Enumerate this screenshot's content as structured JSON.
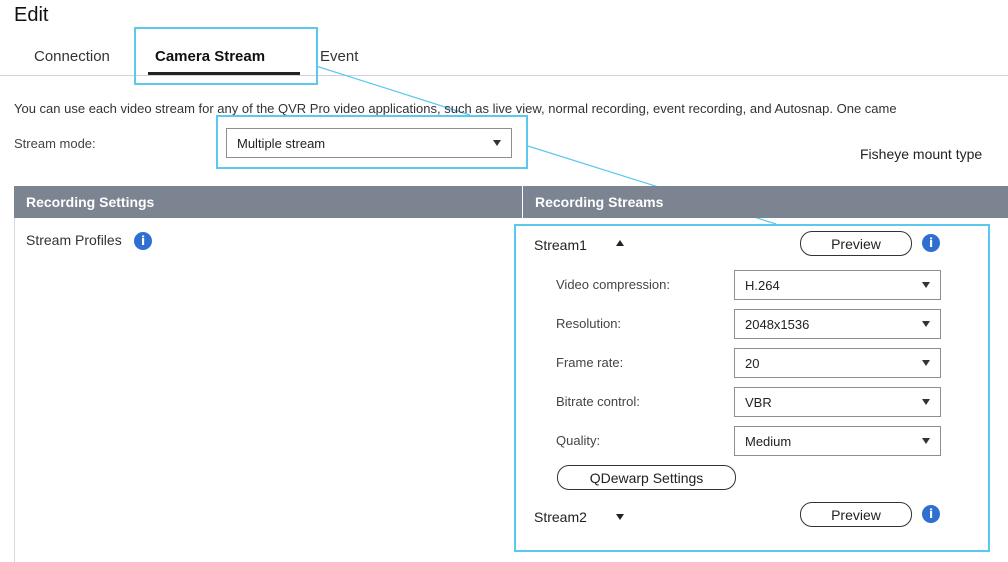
{
  "title": "Edit",
  "tabs": [
    {
      "label": "Connection",
      "active": false
    },
    {
      "label": "Camera Stream",
      "active": true
    },
    {
      "label": "Event",
      "active": false
    }
  ],
  "description": "You can use each video stream for any of the QVR Pro video applications, such as live view, normal recording, event recording, and Autosnap. One came",
  "stream_mode": {
    "label": "Stream mode:",
    "value": "Multiple stream"
  },
  "fisheye_label": "Fisheye mount type",
  "recording_settings": {
    "header": "Recording Settings",
    "stream_profiles_label": "Stream Profiles"
  },
  "recording_streams": {
    "header": "Recording Streams",
    "stream1": {
      "label": "Stream1",
      "preview_label": "Preview",
      "fields": [
        {
          "label": "Video compression:",
          "value": "H.264"
        },
        {
          "label": "Resolution:",
          "value": "2048x1536"
        },
        {
          "label": "Frame rate:",
          "value": "20"
        },
        {
          "label": "Bitrate control:",
          "value": "VBR"
        },
        {
          "label": "Quality:",
          "value": "Medium"
        }
      ],
      "qdewarp_label": "QDewarp Settings"
    },
    "stream2": {
      "label": "Stream2",
      "preview_label": "Preview"
    }
  },
  "icons": {
    "info": "i"
  },
  "colors": {
    "highlight": "#5bc8ef",
    "header_bg": "#7c8491",
    "info_blue": "#2f6fd1"
  }
}
